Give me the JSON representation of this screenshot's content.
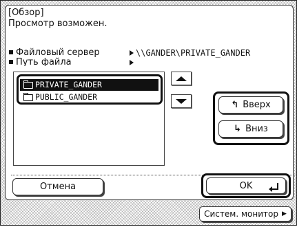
{
  "dialog": {
    "title": "[Обзор]",
    "status": "Просмотр возможен."
  },
  "info": {
    "file_server_label": "Файловый сервер",
    "file_server_value": "\\\\GANDER\\PRIVATE_GANDER",
    "path_label": "Путь файла",
    "path_value": ""
  },
  "folders": {
    "items": [
      {
        "label": "PRIVATE_GANDER",
        "selected": true
      },
      {
        "label": "PUBLIC_GANDER",
        "selected": false
      }
    ]
  },
  "buttons": {
    "up_label": "Вверх",
    "down_label": "Вниз",
    "cancel_label": "Отмена",
    "ok_label": "OK",
    "system_monitor_label": "Систем. монитор"
  },
  "icons": {
    "scroll_up": "triangle-up-icon",
    "scroll_down": "triangle-down-icon",
    "folder": "folder-icon",
    "up": "arrow-up-icon",
    "down": "arrow-down-icon",
    "enter": "enter-icon"
  }
}
